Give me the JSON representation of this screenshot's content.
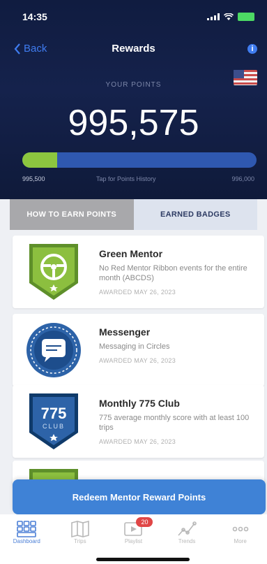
{
  "status_bar": {
    "time": "14:35"
  },
  "nav": {
    "back_label": "Back",
    "title": "Rewards",
    "info_label": "i"
  },
  "points": {
    "label": "YOUR POINTS",
    "value": "995,575",
    "progress_fraction": 0.15,
    "range_start": "995,500",
    "tap_hint": "Tap for Points History",
    "range_end": "996,000"
  },
  "tabs": {
    "earn": "HOW TO EARN POINTS",
    "badges": "EARNED BADGES"
  },
  "badges": [
    {
      "title": "Green Mentor",
      "desc": "No Red Mentor Ribbon events for the entire month (ABCDS)",
      "date": "AWARDED MAY 26, 2023"
    },
    {
      "title": "Messenger",
      "desc": "Messaging in Circles",
      "date": "AWARDED MAY 26, 2023"
    },
    {
      "title": "Monthly 775 Club",
      "desc": "775 average monthly score with at least 100 trips",
      "date": "AWARDED MAY 26, 2023",
      "badge_text": "775",
      "badge_subtext": "CLUB"
    }
  ],
  "redeem_label": "Redeem Mentor Reward Points",
  "tabbar": [
    {
      "label": "Dashboard",
      "icon": "dashboard-icon"
    },
    {
      "label": "Trips",
      "icon": "trips-icon"
    },
    {
      "label": "Playlist",
      "icon": "playlist-icon",
      "badge": "20"
    },
    {
      "label": "Trends",
      "icon": "trends-icon"
    },
    {
      "label": "More",
      "icon": "more-icon"
    }
  ],
  "colors": {
    "navy": "#15224c",
    "accent_blue": "#3f82d6",
    "progress_green": "#8cc63f",
    "notification_red": "#e04646"
  }
}
